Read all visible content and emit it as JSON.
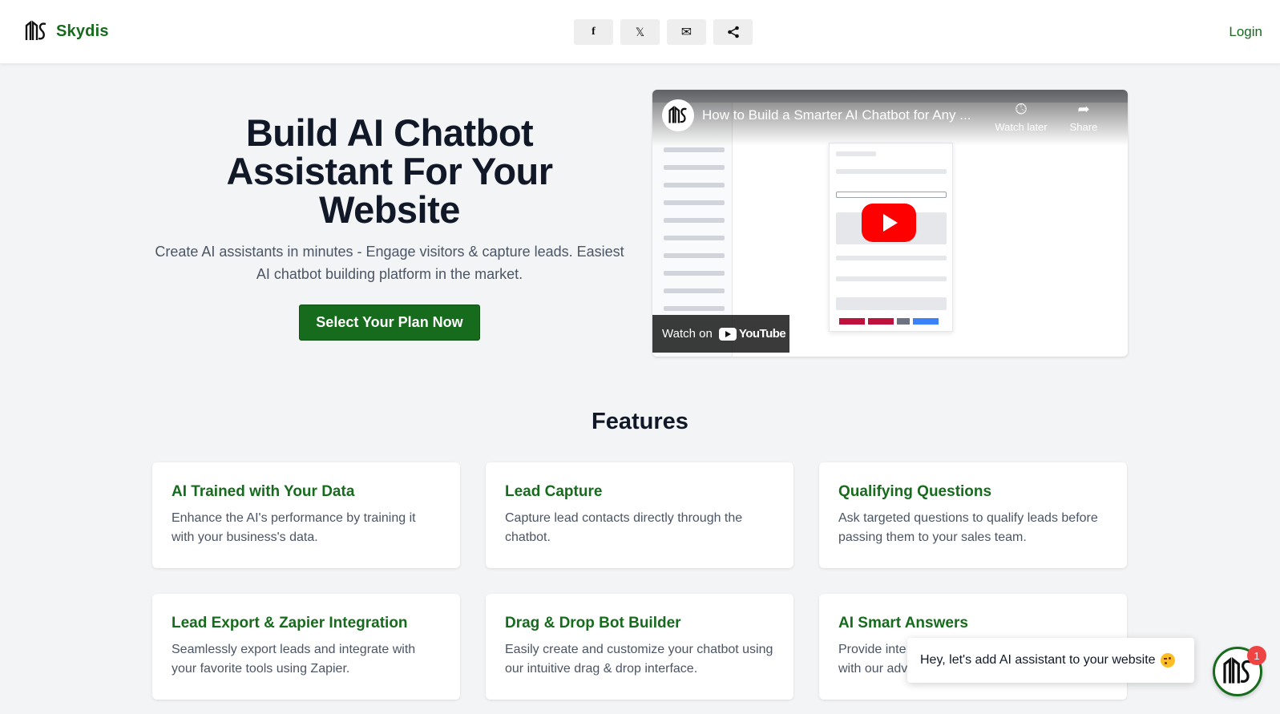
{
  "header": {
    "brand_name": "Skydis",
    "share_buttons": [
      {
        "icon": "facebook-icon",
        "glyph": "f"
      },
      {
        "icon": "x-icon",
        "glyph": "𝕏"
      },
      {
        "icon": "mail-icon",
        "glyph": "✉"
      },
      {
        "icon": "share-icon",
        "glyph": "⋖"
      }
    ],
    "login_label": "Login"
  },
  "hero": {
    "title_line1": "Build AI Chatbot",
    "title_line2": "Assistant For Your",
    "title_line3": "Website",
    "subtitle": "Create AI assistants in minutes - Engage visitors & capture leads. Easiest AI chatbot building platform in the market.",
    "cta_label": "Select Your Plan Now"
  },
  "video": {
    "title": "How to Build a Smarter AI Chatbot for Any ...",
    "watch_later_label": "Watch later",
    "share_label": "Share",
    "watch_on_label": "Watch on",
    "youtube_label": "YouTube"
  },
  "features": {
    "title": "Features",
    "items": [
      {
        "title": "AI Trained with Your Data",
        "description": "Enhance the AI's performance by training it with your business's data."
      },
      {
        "title": "Lead Capture",
        "description": "Capture lead contacts directly through the chatbot."
      },
      {
        "title": "Qualifying Questions",
        "description": "Ask targeted questions to qualify leads before passing them to your sales team."
      },
      {
        "title": "Lead Export & Zapier Integration",
        "description": "Seamlessly export leads and integrate with your favorite tools using Zapier."
      },
      {
        "title": "Drag & Drop Bot Builder",
        "description": "Easily create and customize your chatbot using our intuitive drag & drop interface."
      },
      {
        "title": "AI Smart Answers",
        "description": "Provide inte with our adv"
      }
    ]
  },
  "chat_widget": {
    "message": "Hey, let's add AI assistant to your website",
    "badge_count": "1"
  },
  "colors": {
    "brand_green": "#166b1c",
    "background": "#f3f4f6",
    "youtube_red": "#ff0000"
  }
}
